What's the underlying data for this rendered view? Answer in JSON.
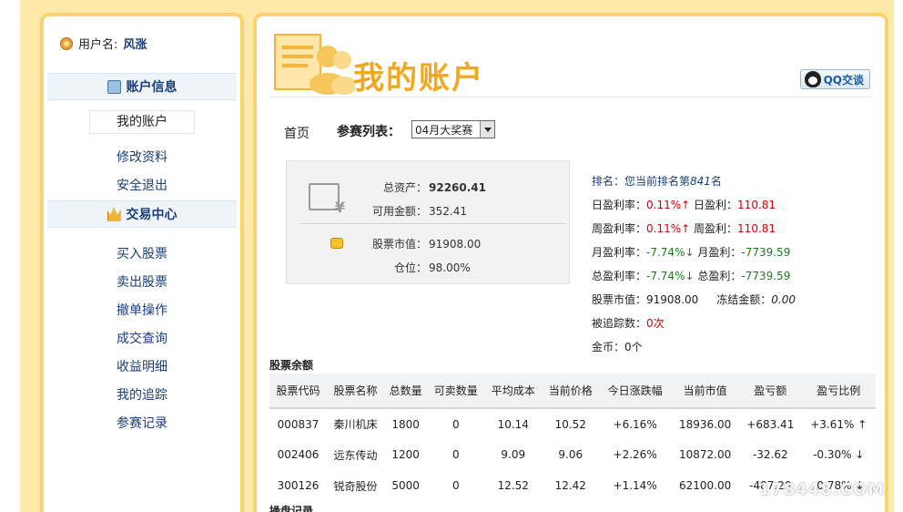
{
  "sidebar": {
    "user_label": "用户名:",
    "user_name": "风涨",
    "account_section": "账户信息",
    "account_items": [
      "我的账户",
      "修改资料",
      "安全退出"
    ],
    "trade_section": "交易中心",
    "trade_items": [
      "买入股票",
      "卖出股票",
      "撤单操作",
      "成交查询",
      "收益明细",
      "我的追踪",
      "参赛记录"
    ]
  },
  "header": {
    "title": "我的账户",
    "qq_label": "QQ交谈"
  },
  "nav": {
    "home": "首页",
    "contest_label": "参赛列表：",
    "contest_selected": "04月大奖赛"
  },
  "assets": {
    "total_label": "总资产：",
    "total_value": "92260.41",
    "available_label": "可用金额：",
    "available_value": "352.41",
    "stock_value_label": "股票市值：",
    "stock_value": "91908.00",
    "position_label": "仓位：",
    "position_value": "98.00%"
  },
  "stats": {
    "rank_prefix": "排名：您当前排名第",
    "rank_value": "841",
    "rank_suffix": "名",
    "day_rate_label": "日盈利率：",
    "day_rate": "0.11%↑",
    "day_profit_label": "日盈利：",
    "day_profit": "110.81",
    "week_rate_label": "周盈利率：",
    "week_rate": "0.11%↑",
    "week_profit_label": "周盈利：",
    "week_profit": "110.81",
    "month_rate_label": "月盈利率：",
    "month_rate": "-7.74%↓",
    "month_profit_label": "月盈利：",
    "month_profit": "-7739.59",
    "total_rate_label": "总盈利率：",
    "total_rate": "-7.74%↓",
    "total_profit_label": "总盈利：",
    "total_profit": "-7739.59",
    "stock_value_label": "股票市值：",
    "stock_value": "91908.00",
    "frozen_label": "冻结金额：",
    "frozen_value": "0.00",
    "tracked_label": "被追踪数：",
    "tracked_value": "0次",
    "coins_label": "金币：",
    "coins_value": "0个"
  },
  "holdings": {
    "section_title": "股票余额",
    "headers": [
      "股票代码",
      "股票名称",
      "总数量",
      "可卖数量",
      "平均成本",
      "当前价格",
      "今日涨跌幅",
      "当前市值",
      "盈亏额",
      "盈亏比例"
    ],
    "rows": [
      {
        "code": "000837",
        "name": "秦川机床",
        "qty": "1800",
        "sellable": "0",
        "avg_cost": "10.14",
        "price": "10.52",
        "change": "+6.16%",
        "market_value": "18936.00",
        "pnl": "+683.41",
        "pnl_rate": "+3.61% ↑",
        "color": "#d40000"
      },
      {
        "code": "002406",
        "name": "远东传动",
        "qty": "1200",
        "sellable": "0",
        "avg_cost": "9.09",
        "price": "9.06",
        "change": "+2.26%",
        "market_value": "10872.00",
        "pnl": "-32.62",
        "pnl_rate": "-0.30% ↓",
        "color": "#1f7a1f"
      },
      {
        "code": "300126",
        "name": "锐奇股份",
        "qty": "5000",
        "sellable": "0",
        "avg_cost": "12.52",
        "price": "12.42",
        "change": "+1.14%",
        "market_value": "62100.00",
        "pnl": "-487.20",
        "pnl_rate": "-0.78% ↓",
        "color": "#1f7a1f"
      }
    ]
  },
  "trades": {
    "section_title": "操盘记录"
  },
  "watermark": "178448.COM"
}
